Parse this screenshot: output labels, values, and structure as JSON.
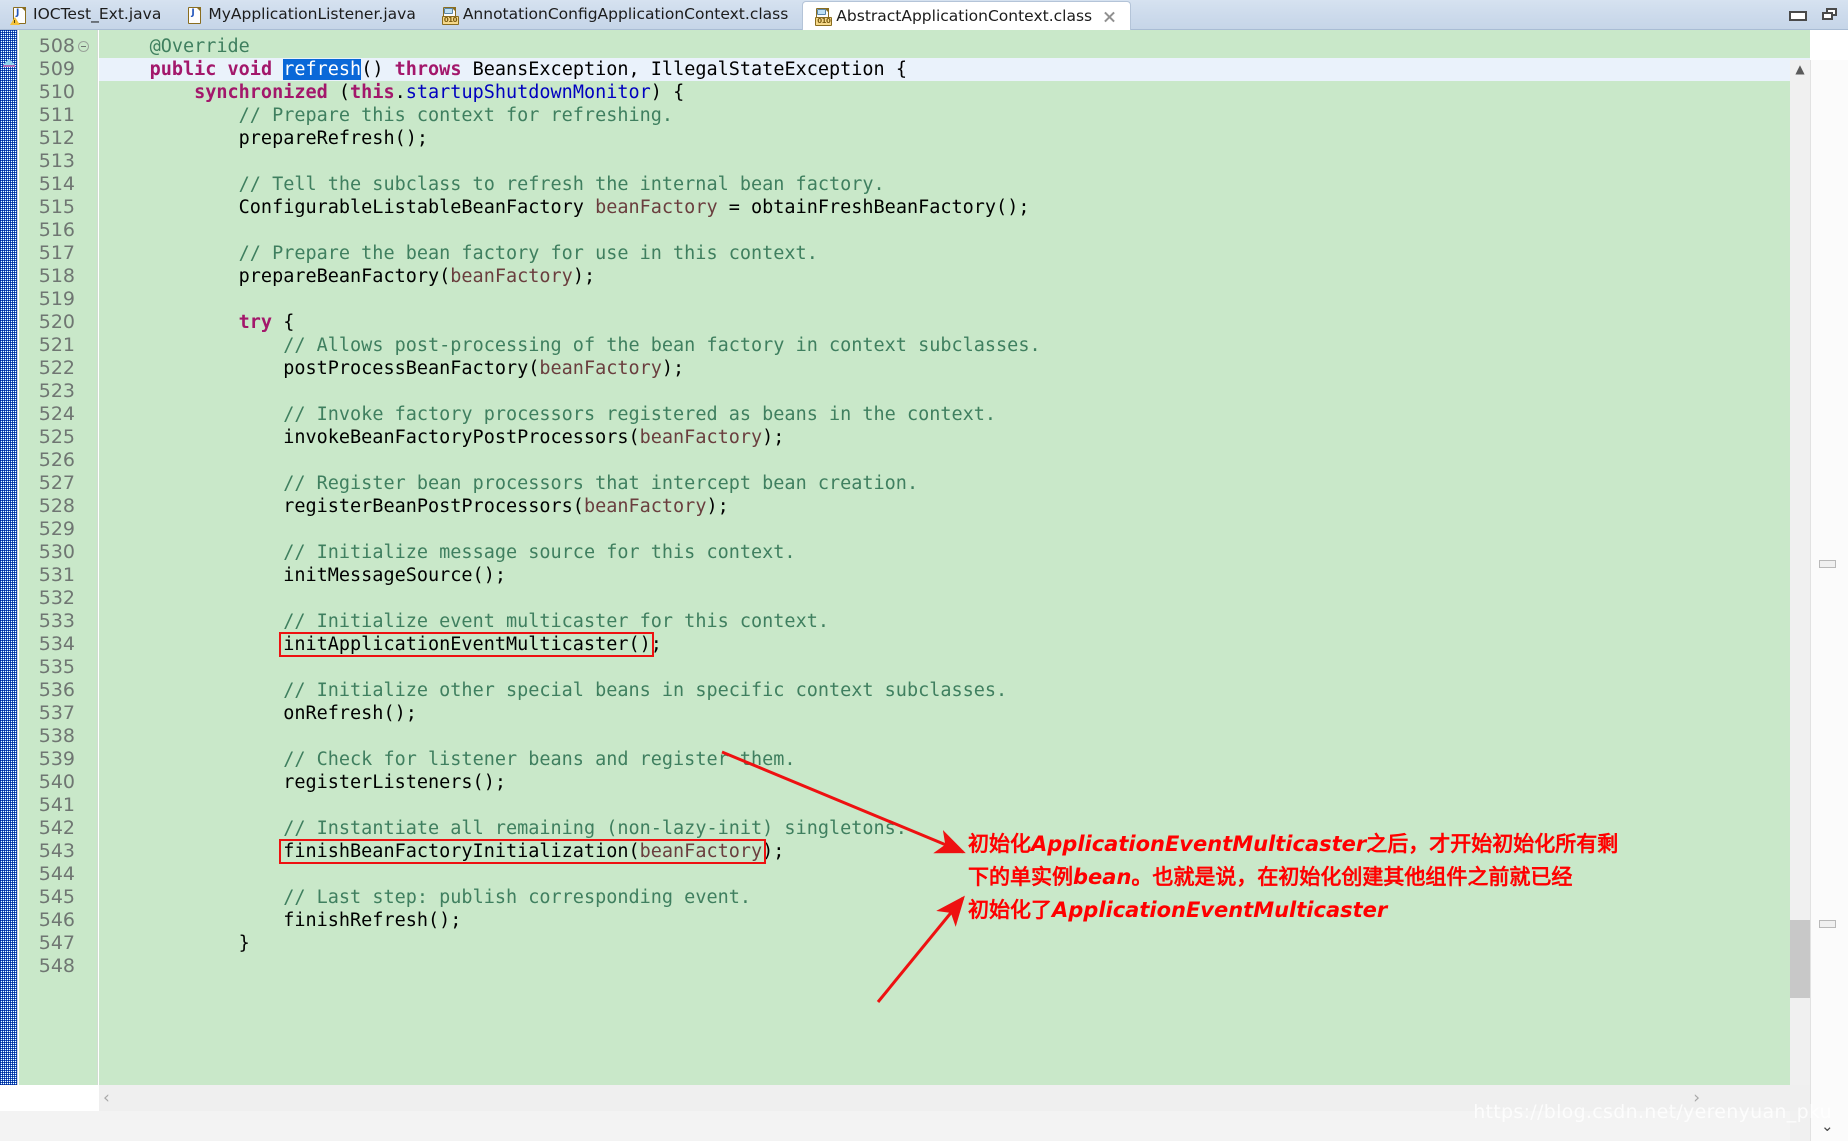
{
  "window": {
    "minimize_label": "Minimize",
    "restore_label": "Restore"
  },
  "tabs": [
    {
      "label": "IOCTest_Ext.java",
      "icon": "java-file-warning-icon",
      "type": "java",
      "active": false,
      "closable": false
    },
    {
      "label": "MyApplicationListener.java",
      "icon": "java-file-icon",
      "type": "java",
      "active": false,
      "closable": false
    },
    {
      "label": "AnnotationConfigApplicationContext.class",
      "icon": "class-file-icon",
      "type": "class",
      "active": false,
      "closable": false
    },
    {
      "label": "AbstractApplicationContext.class",
      "icon": "class-file-icon",
      "type": "class",
      "active": true,
      "closable": true
    }
  ],
  "editor": {
    "first_line": 508,
    "current_line": 509,
    "selected_token": "refresh",
    "line_numbers": [
      508,
      509,
      510,
      511,
      512,
      513,
      514,
      515,
      516,
      517,
      518,
      519,
      520,
      521,
      522,
      523,
      524,
      525,
      526,
      527,
      528,
      529,
      530,
      531,
      532,
      533,
      534,
      535,
      536,
      537,
      538,
      539,
      540,
      541,
      542,
      543,
      544,
      545,
      546,
      547,
      548
    ],
    "lines": [
      {
        "n": 508,
        "tokens": [
          {
            "t": "    ",
            "c": "plain"
          },
          {
            "t": "@Override",
            "c": "cmt"
          }
        ],
        "fold": true
      },
      {
        "n": 509,
        "tokens": [
          {
            "t": "    ",
            "c": "plain"
          },
          {
            "t": "public",
            "c": "kw"
          },
          {
            "t": " ",
            "c": "plain"
          },
          {
            "t": "void",
            "c": "kw"
          },
          {
            "t": " ",
            "c": "plain"
          },
          {
            "t": "refresh",
            "c": "sel"
          },
          {
            "t": "() ",
            "c": "plain"
          },
          {
            "t": "throws",
            "c": "kw"
          },
          {
            "t": " BeansException, IllegalStateException {",
            "c": "plain"
          }
        ]
      },
      {
        "n": 510,
        "tokens": [
          {
            "t": "        ",
            "c": "plain"
          },
          {
            "t": "synchronized",
            "c": "kw"
          },
          {
            "t": " (",
            "c": "plain"
          },
          {
            "t": "this",
            "c": "kw"
          },
          {
            "t": ".",
            "c": "plain"
          },
          {
            "t": "startupShutdownMonitor",
            "c": "fld"
          },
          {
            "t": ") {",
            "c": "plain"
          }
        ]
      },
      {
        "n": 511,
        "tokens": [
          {
            "t": "            ",
            "c": "plain"
          },
          {
            "t": "// Prepare this context for refreshing.",
            "c": "cmt"
          }
        ]
      },
      {
        "n": 512,
        "tokens": [
          {
            "t": "            prepareRefresh();",
            "c": "plain"
          }
        ]
      },
      {
        "n": 513,
        "tokens": []
      },
      {
        "n": 514,
        "tokens": [
          {
            "t": "            ",
            "c": "plain"
          },
          {
            "t": "// Tell the subclass to refresh the internal bean factory.",
            "c": "cmt"
          }
        ]
      },
      {
        "n": 515,
        "tokens": [
          {
            "t": "            ConfigurableListableBeanFactory ",
            "c": "plain"
          },
          {
            "t": "beanFactory",
            "c": "param"
          },
          {
            "t": " = obtainFreshBeanFactory();",
            "c": "plain"
          }
        ]
      },
      {
        "n": 516,
        "tokens": []
      },
      {
        "n": 517,
        "tokens": [
          {
            "t": "            ",
            "c": "plain"
          },
          {
            "t": "// Prepare the bean factory for use in this context.",
            "c": "cmt"
          }
        ]
      },
      {
        "n": 518,
        "tokens": [
          {
            "t": "            prepareBeanFactory(",
            "c": "plain"
          },
          {
            "t": "beanFactory",
            "c": "param"
          },
          {
            "t": ");",
            "c": "plain"
          }
        ]
      },
      {
        "n": 519,
        "tokens": []
      },
      {
        "n": 520,
        "tokens": [
          {
            "t": "            ",
            "c": "plain"
          },
          {
            "t": "try",
            "c": "kw"
          },
          {
            "t": " {",
            "c": "plain"
          }
        ]
      },
      {
        "n": 521,
        "tokens": [
          {
            "t": "                ",
            "c": "plain"
          },
          {
            "t": "// Allows post-processing of the bean factory in context subclasses.",
            "c": "cmt"
          }
        ]
      },
      {
        "n": 522,
        "tokens": [
          {
            "t": "                postProcessBeanFactory(",
            "c": "plain"
          },
          {
            "t": "beanFactory",
            "c": "param"
          },
          {
            "t": ");",
            "c": "plain"
          }
        ]
      },
      {
        "n": 523,
        "tokens": []
      },
      {
        "n": 524,
        "tokens": [
          {
            "t": "                ",
            "c": "plain"
          },
          {
            "t": "// Invoke factory processors registered as beans in the context.",
            "c": "cmt"
          }
        ]
      },
      {
        "n": 525,
        "tokens": [
          {
            "t": "                invokeBeanFactoryPostProcessors(",
            "c": "plain"
          },
          {
            "t": "beanFactory",
            "c": "param"
          },
          {
            "t": ");",
            "c": "plain"
          }
        ]
      },
      {
        "n": 526,
        "tokens": []
      },
      {
        "n": 527,
        "tokens": [
          {
            "t": "                ",
            "c": "plain"
          },
          {
            "t": "// Register bean processors that intercept bean creation.",
            "c": "cmt"
          }
        ]
      },
      {
        "n": 528,
        "tokens": [
          {
            "t": "                registerBeanPostProcessors(",
            "c": "plain"
          },
          {
            "t": "beanFactory",
            "c": "param"
          },
          {
            "t": ");",
            "c": "plain"
          }
        ]
      },
      {
        "n": 529,
        "tokens": []
      },
      {
        "n": 530,
        "tokens": [
          {
            "t": "                ",
            "c": "plain"
          },
          {
            "t": "// Initialize message source for this context.",
            "c": "cmt"
          }
        ]
      },
      {
        "n": 531,
        "tokens": [
          {
            "t": "                initMessageSource();",
            "c": "plain"
          }
        ]
      },
      {
        "n": 532,
        "tokens": []
      },
      {
        "n": 533,
        "tokens": [
          {
            "t": "                ",
            "c": "plain"
          },
          {
            "t": "// Initialize event multicaster for this context.",
            "c": "cmt"
          }
        ]
      },
      {
        "n": 534,
        "tokens": [
          {
            "t": "                initApplicationEventMulticaster();",
            "c": "plain"
          }
        ]
      },
      {
        "n": 535,
        "tokens": []
      },
      {
        "n": 536,
        "tokens": [
          {
            "t": "                ",
            "c": "plain"
          },
          {
            "t": "// Initialize other special beans in specific context subclasses.",
            "c": "cmt"
          }
        ]
      },
      {
        "n": 537,
        "tokens": [
          {
            "t": "                onRefresh();",
            "c": "plain"
          }
        ]
      },
      {
        "n": 538,
        "tokens": []
      },
      {
        "n": 539,
        "tokens": [
          {
            "t": "                ",
            "c": "plain"
          },
          {
            "t": "// Check for listener beans and register them.",
            "c": "cmt"
          }
        ]
      },
      {
        "n": 540,
        "tokens": [
          {
            "t": "                registerListeners();",
            "c": "plain"
          }
        ]
      },
      {
        "n": 541,
        "tokens": []
      },
      {
        "n": 542,
        "tokens": [
          {
            "t": "                ",
            "c": "plain"
          },
          {
            "t": "// Instantiate all remaining (non-lazy-init) singletons.",
            "c": "cmt"
          }
        ]
      },
      {
        "n": 543,
        "tokens": [
          {
            "t": "                finishBeanFactoryInitialization(",
            "c": "plain"
          },
          {
            "t": "beanFactory",
            "c": "param"
          },
          {
            "t": ");",
            "c": "plain"
          }
        ]
      },
      {
        "n": 544,
        "tokens": []
      },
      {
        "n": 545,
        "tokens": [
          {
            "t": "                ",
            "c": "plain"
          },
          {
            "t": "// Last step: publish corresponding event.",
            "c": "cmt"
          }
        ]
      },
      {
        "n": 546,
        "tokens": [
          {
            "t": "                finishRefresh();",
            "c": "plain"
          }
        ]
      },
      {
        "n": 547,
        "tokens": [
          {
            "t": "            }",
            "c": "plain"
          }
        ]
      },
      {
        "n": 548,
        "tokens": []
      }
    ]
  },
  "annotation": {
    "color": "#ff0000",
    "boxes": [
      {
        "name": "init-application-event-multicaster",
        "target_line": 534
      },
      {
        "name": "finish-bean-factory-initialization",
        "target_line": 543
      }
    ],
    "note_lines": [
      "初始化ApplicationEventMulticaster之后，才开始初始化所有剩",
      "下的单实例bean。也就是说，在初始化创建其他组件之前就已经",
      "初始化了ApplicationEventMulticaster"
    ]
  },
  "watermark": {
    "text": "https://blog.csdn.net/yerenyuan_pku"
  },
  "scrollbars": {
    "vertical_up_arrow": "▲",
    "horizontal_left_arrow": "‹",
    "horizontal_right_arrow": "›",
    "overview_down_arrow": "⌄"
  }
}
